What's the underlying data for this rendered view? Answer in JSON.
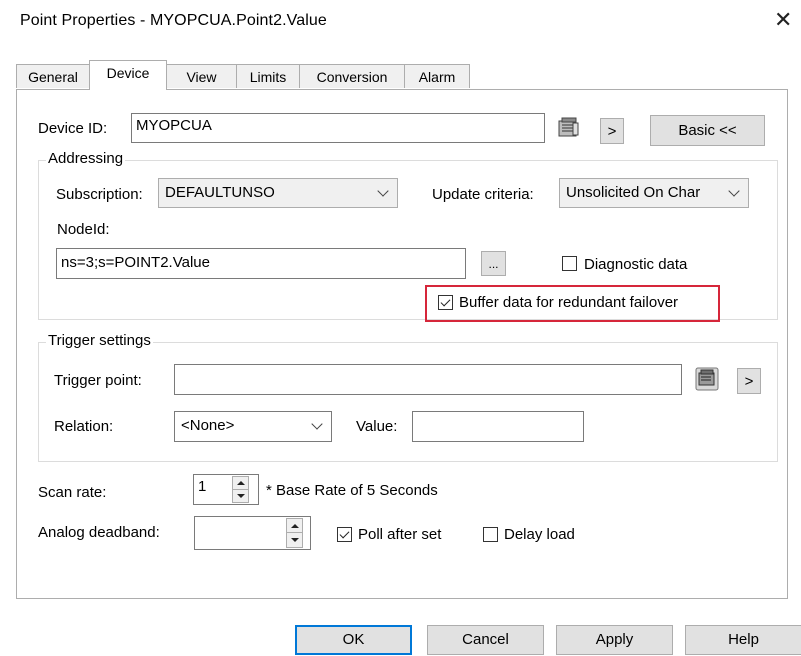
{
  "window": {
    "title": "Point Properties - MYOPCUA.Point2.Value",
    "close_glyph": "✕"
  },
  "tabs": [
    {
      "label": "General"
    },
    {
      "label": "Device"
    },
    {
      "label": "View"
    },
    {
      "label": "Limits"
    },
    {
      "label": "Conversion"
    },
    {
      "label": "Alarm"
    }
  ],
  "active_tab": "Device",
  "device": {
    "label": "Device ID:",
    "value": "MYOPCUA",
    "arrow_label": ">",
    "basic_label": "Basic <<"
  },
  "addressing": {
    "group_label": "Addressing",
    "subscription_label": "Subscription:",
    "subscription_value": "DEFAULTUNSO",
    "update_label": "Update criteria:",
    "update_value": "Unsolicited On Char",
    "nodeid_label": "NodeId:",
    "nodeid_value": "ns=3;s=POINT2.Value",
    "ellipsis_label": "...",
    "diagnostic_label": "Diagnostic data",
    "diagnostic_checked": false,
    "buffer_label": "Buffer data for redundant failover",
    "buffer_checked": true
  },
  "trigger": {
    "group_label": "Trigger settings",
    "point_label": "Trigger point:",
    "point_value": "",
    "arrow_label": ">",
    "relation_label": "Relation:",
    "relation_value": "<None>",
    "value_label": "Value:",
    "value_value": ""
  },
  "scan": {
    "label": "Scan rate:",
    "value": "1",
    "note": "* Base Rate of 5 Seconds"
  },
  "deadband": {
    "label": "Analog deadband:",
    "value": "",
    "poll_label": "Poll after set",
    "poll_checked": true,
    "delay_label": "Delay load",
    "delay_checked": false
  },
  "footer": {
    "ok": "OK",
    "cancel": "Cancel",
    "apply": "Apply",
    "help": "Help"
  },
  "colors": {
    "highlight": "#d6263a",
    "default_button_border": "#0078d7"
  }
}
